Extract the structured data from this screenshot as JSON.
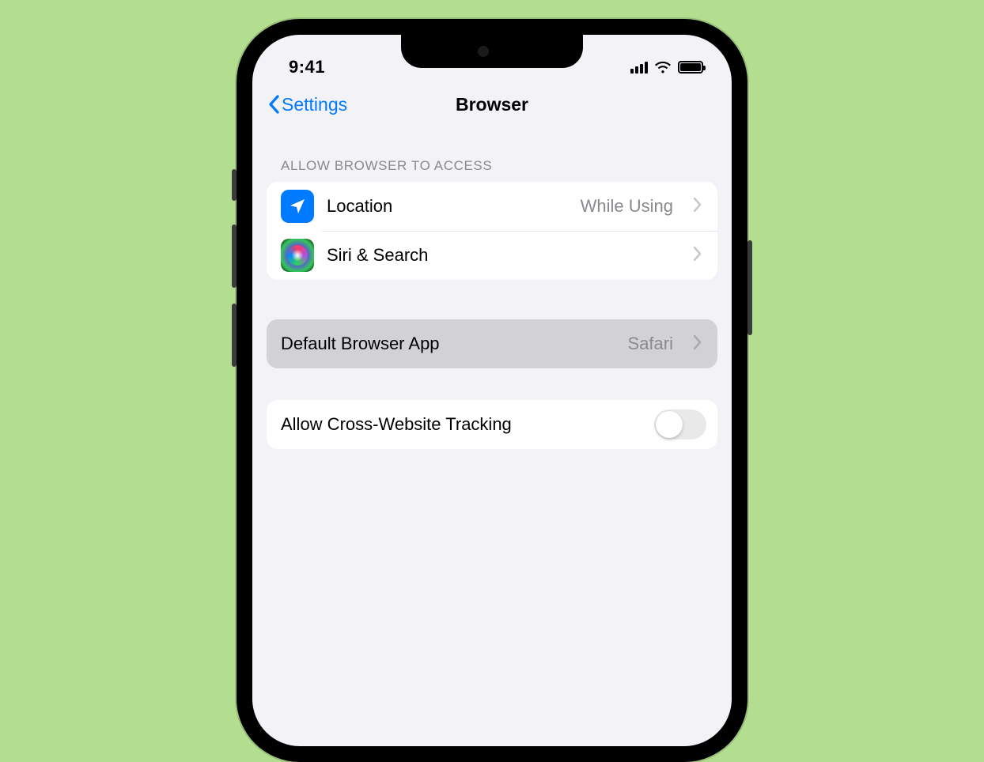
{
  "status": {
    "time": "9:41"
  },
  "nav": {
    "back_label": "Settings",
    "title": "Browser"
  },
  "sections": {
    "allow_access": {
      "header": "Allow Browser to Access",
      "location": {
        "label": "Location",
        "value": "While Using"
      },
      "siri": {
        "label": "Siri & Search"
      }
    },
    "default_browser": {
      "label": "Default Browser App",
      "value": "Safari"
    },
    "tracking": {
      "label": "Allow Cross-Website Tracking",
      "enabled": false
    }
  }
}
